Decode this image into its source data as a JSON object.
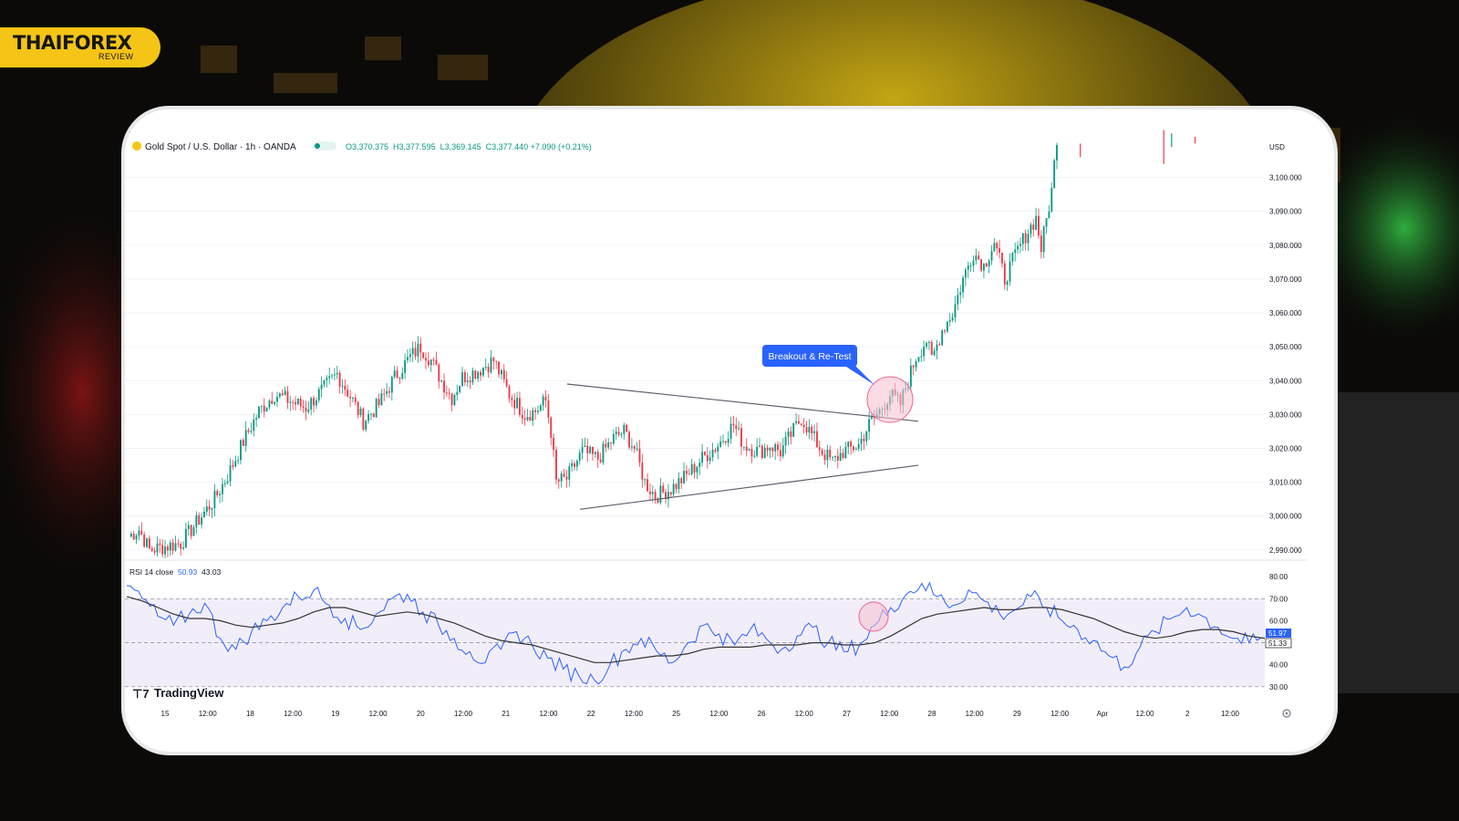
{
  "brand": {
    "name": "THAIFOREX",
    "sub": "REVIEW"
  },
  "colors": {
    "up": "#089981",
    "down": "#f23645",
    "rsi": "#2962ff",
    "rsi_ma": "#333333",
    "annotation": "#2962ff",
    "highlight": "#f8bfd0",
    "brand_yellow": "#f4c516"
  },
  "header": {
    "symbol": "Gold Spot / U.S. Dollar · 1h · OANDA",
    "ohlc": "O3,370.375  H3,377.595  L3,369.145  C3,377.440 +7.090 (+0.21%)"
  },
  "currency": "USD",
  "watermark": "TradingView",
  "annotation": "Breakout & Re-Test",
  "rsi": {
    "label": "RSI 14 close",
    "value1": "50.93",
    "value2": "43.03",
    "tag1": "51.97",
    "tag2": "51.33",
    "levels": [
      "80.00",
      "70.00",
      "60.00",
      "50.00",
      "40.00",
      "30.00"
    ]
  },
  "chart_data": [
    {
      "type": "candlestick",
      "title": "Gold Spot / U.S. Dollar · 1h · OANDA",
      "y_axis": [
        "3,100.000",
        "3,090.000",
        "3,080.000",
        "3,070.000",
        "3,060.000",
        "3,050.000",
        "3,040.000",
        "3,030.000",
        "3,020.000",
        "3,010.000",
        "3,000.000",
        "2,990.000"
      ],
      "ylim": [
        2987,
        3112
      ],
      "x_ticks": [
        "15",
        "12:00",
        "18",
        "12:00",
        "19",
        "12:00",
        "20",
        "12:00",
        "21",
        "12:00",
        "22",
        "12:00",
        "25",
        "12:00",
        "26",
        "12:00",
        "27",
        "12:00",
        "28",
        "12:00",
        "29",
        "12:00",
        "Apr",
        "12:00",
        "2",
        "12:00"
      ],
      "path_points": [
        [
          0,
          2994
        ],
        [
          4,
          2996
        ],
        [
          8,
          2990
        ],
        [
          14,
          2991
        ],
        [
          20,
          2992
        ],
        [
          27,
          2999
        ],
        [
          33,
          3005
        ],
        [
          38,
          3012
        ],
        [
          44,
          3022
        ],
        [
          50,
          3031
        ],
        [
          56,
          3036
        ],
        [
          62,
          3034
        ],
        [
          68,
          3032
        ],
        [
          74,
          3037
        ],
        [
          80,
          3042
        ],
        [
          86,
          3034
        ],
        [
          90,
          3028
        ],
        [
          96,
          3033
        ],
        [
          102,
          3041
        ],
        [
          108,
          3047
        ],
        [
          112,
          3050
        ],
        [
          116,
          3046
        ],
        [
          120,
          3040
        ],
        [
          124,
          3035
        ],
        [
          128,
          3041
        ],
        [
          134,
          3043
        ],
        [
          140,
          3046
        ],
        [
          146,
          3036
        ],
        [
          152,
          3030
        ],
        [
          156,
          3031
        ],
        [
          160,
          3034
        ],
        [
          162,
          3025
        ],
        [
          164,
          3010
        ],
        [
          168,
          3011
        ],
        [
          174,
          3019
        ],
        [
          180,
          3017
        ],
        [
          186,
          3023
        ],
        [
          190,
          3025
        ],
        [
          194,
          3020
        ],
        [
          198,
          3010
        ],
        [
          202,
          3006
        ],
        [
          208,
          3008
        ],
        [
          214,
          3012
        ],
        [
          220,
          3017
        ],
        [
          226,
          3021
        ],
        [
          232,
          3027
        ],
        [
          236,
          3021
        ],
        [
          242,
          3019
        ],
        [
          246,
          3021
        ],
        [
          250,
          3019
        ],
        [
          254,
          3024
        ],
        [
          258,
          3029
        ],
        [
          262,
          3024
        ],
        [
          266,
          3019
        ],
        [
          270,
          3016
        ],
        [
          274,
          3019
        ],
        [
          280,
          3021
        ],
        [
          284,
          3027
        ],
        [
          288,
          3031
        ],
        [
          292,
          3036
        ],
        [
          296,
          3033
        ],
        [
          298,
          3038
        ],
        [
          302,
          3047
        ],
        [
          306,
          3052
        ],
        [
          308,
          3046
        ],
        [
          312,
          3055
        ],
        [
          316,
          3060
        ],
        [
          320,
          3070
        ],
        [
          324,
          3078
        ],
        [
          328,
          3074
        ],
        [
          332,
          3081
        ],
        [
          336,
          3070
        ],
        [
          340,
          3077
        ],
        [
          344,
          3083
        ],
        [
          348,
          3088
        ],
        [
          350,
          3079
        ],
        [
          354,
          3096
        ],
        [
          356,
          3112
        ]
      ],
      "gap_tail": [
        [
          365,
          3106,
          3110
        ],
        [
          397,
          3104,
          3114
        ],
        [
          400,
          3109,
          3113
        ],
        [
          409,
          3110,
          3112
        ]
      ],
      "triangle_upper": [
        [
          0,
          3039
        ],
        [
          1,
          3028
        ]
      ],
      "triangle_lower": [
        [
          0,
          3002
        ],
        [
          1,
          3015
        ]
      ]
    },
    {
      "type": "line",
      "title": "RSI 14 close",
      "ylim": [
        27,
        83
      ],
      "series": [
        {
          "values": [
            76,
            70,
            62,
            58,
            63,
            68,
            52,
            47,
            55,
            60,
            66,
            71,
            74,
            67,
            61,
            56,
            63,
            70,
            72,
            64,
            58,
            52,
            46,
            41,
            47,
            55,
            49,
            43,
            38,
            35,
            33,
            40,
            47,
            52,
            46,
            41,
            50,
            58,
            54,
            49,
            56,
            52,
            47,
            53,
            57,
            50,
            46,
            49,
            58,
            66,
            72,
            77,
            71,
            67,
            74,
            69,
            63,
            65,
            71,
            66,
            60,
            56,
            51,
            44,
            39,
            48,
            55,
            61,
            66,
            62,
            57,
            52,
            50,
            52
          ]
        },
        {
          "values": [
            71,
            69,
            66,
            63,
            61,
            61,
            60,
            58,
            57,
            58,
            59,
            61,
            64,
            66,
            66,
            64,
            62,
            63,
            64,
            63,
            61,
            59,
            56,
            53,
            51,
            50,
            49,
            47,
            45,
            43,
            41,
            41,
            42,
            43,
            44,
            44,
            45,
            47,
            48,
            48,
            48,
            49,
            49,
            49,
            50,
            50,
            49,
            49,
            50,
            53,
            57,
            61,
            63,
            64,
            65,
            66,
            65,
            65,
            66,
            66,
            65,
            63,
            61,
            58,
            55,
            53,
            52,
            53,
            55,
            56,
            56,
            55,
            53,
            52
          ]
        }
      ]
    }
  ]
}
